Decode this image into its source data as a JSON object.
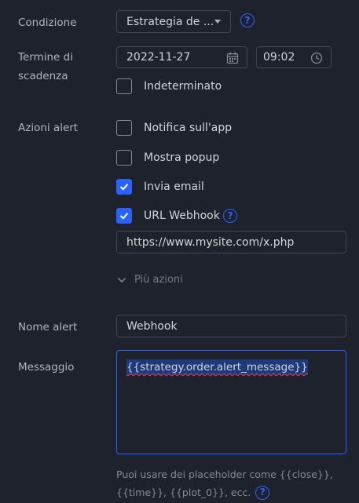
{
  "condition": {
    "label": "Condizione",
    "value": "Estrategia de ..."
  },
  "expiry": {
    "label_line1": "Termine di",
    "label_line2": "scadenza",
    "date": "2022-11-27",
    "time": "09:02",
    "indefinite_label": "Indeterminato",
    "indefinite_checked": false
  },
  "actions": {
    "label": "Azioni alert",
    "items": [
      {
        "label": "Notifica sull'app",
        "checked": false
      },
      {
        "label": "Mostra popup",
        "checked": false
      },
      {
        "label": "Invia email",
        "checked": true
      },
      {
        "label": "URL Webhook",
        "checked": true
      }
    ],
    "webhook_url": "https://www.mysite.com/x.php",
    "more_label": "Più azioni"
  },
  "alert_name": {
    "label": "Nome alert",
    "value": "Webhook"
  },
  "message": {
    "label": "Messaggio",
    "value": "{{strategy.order.alert_message}}",
    "hint_line1": "Puoi usare dei placeholder come {{close}},",
    "hint_line2": "{{time}}, {{plot_0}}, ecc."
  },
  "colors": {
    "background": "#1e222d",
    "accent": "#2962ff",
    "border": "#434651",
    "label": "#b2b5be",
    "text": "#d1d4dc"
  }
}
